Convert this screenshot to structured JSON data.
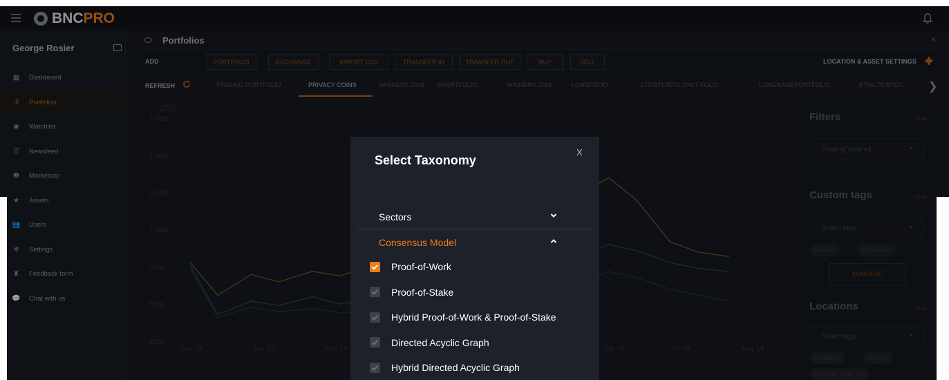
{
  "brand": {
    "name": "BNC",
    "suffix": "PRO"
  },
  "sidebar": {
    "user_name": "George Rosier",
    "items": [
      {
        "label": "Dashboard",
        "icon": "dashboard-icon",
        "active": false
      },
      {
        "label": "Portfolios",
        "icon": "bar-chart-icon",
        "active": true
      },
      {
        "label": "Watchlist",
        "icon": "eye-icon",
        "active": false
      },
      {
        "label": "Newsfeed",
        "icon": "list-icon",
        "active": false
      },
      {
        "label": "Marketcap",
        "icon": "bitcoin-icon",
        "active": false
      },
      {
        "label": "Assets",
        "icon": "star-icon",
        "active": false
      },
      {
        "label": "Users",
        "icon": "users-icon",
        "active": false
      },
      {
        "label": "Settings",
        "icon": "gear-icon",
        "active": false
      },
      {
        "label": "Feedback form",
        "icon": "feedback-icon",
        "active": false
      },
      {
        "label": "Chat with us",
        "icon": "chat-icon",
        "active": false
      }
    ]
  },
  "page": {
    "title": "Portfolios",
    "add_label": "ADD",
    "add_buttons": [
      "PORTFOLIO",
      "EXCHANGE",
      "IMPORT CSV",
      "TRANSFER IN",
      "TRANSFER OUT",
      "BUY",
      "SELL"
    ],
    "location_settings": "LOCATION & ASSET SETTINGS",
    "refresh_label": "REFRESH",
    "tabs": [
      "TRADING PORTFOLIO",
      "PRIVACY COINS",
      "WINNERS 2019",
      "SHORTFOLIO",
      "WINNERS 2018",
      "LONGFOLIO",
      "LTC/BTC/ETC ONLY FOLIO",
      "LONGNAMEPORTFOLIO",
      "ETH/LTC/BTC/..."
    ],
    "active_tab": "PRIVACY COINS"
  },
  "chart_data": {
    "type": "line",
    "ylabel": "USD",
    "y_ticks": [
      "1 750k",
      "1 500k",
      "1 250k",
      "1 000k",
      "750k",
      "500k",
      "250k"
    ],
    "x_ticks": [
      "Dec '18",
      "Jan '19",
      "Feb '19",
      "Jun '19",
      "Jul '19",
      "Aug '19"
    ],
    "ylim": [
      250000,
      1750000
    ],
    "series": [
      {
        "color": "#a5ad2a",
        "x": [
          "2018-12-01",
          "2018-12-15",
          "2019-01-01",
          "2019-01-15",
          "2019-02-01",
          "2019-02-15",
          "2019-06-01",
          "2019-06-15",
          "2019-07-01",
          "2019-07-15",
          "2019-08-01",
          "2019-08-15",
          "2019-08-31"
        ],
        "values": [
          780000,
          560000,
          700000,
          650000,
          720000,
          690000,
          1150000,
          1220000,
          1350000,
          1200000,
          920000,
          850000,
          820000
        ]
      },
      {
        "color": "#2a7d86",
        "x": [
          "2018-12-01",
          "2018-12-15",
          "2019-01-01",
          "2019-01-15",
          "2019-02-01",
          "2019-02-15",
          "2019-06-01",
          "2019-06-15",
          "2019-07-01",
          "2019-07-15",
          "2019-08-01",
          "2019-08-15",
          "2019-08-31"
        ],
        "values": [
          760000,
          430000,
          520000,
          490000,
          550000,
          500000,
          780000,
          820000,
          900000,
          860000,
          780000,
          740000,
          720000
        ]
      },
      {
        "color": "#2f4f5a",
        "x": [
          "2018-12-01",
          "2018-12-15",
          "2019-01-01",
          "2019-01-15",
          "2019-02-01",
          "2019-02-15",
          "2019-06-01",
          "2019-06-15",
          "2019-07-01",
          "2019-07-15",
          "2019-08-01",
          "2019-08-15",
          "2019-08-31"
        ],
        "values": [
          740000,
          410000,
          480000,
          450000,
          470000,
          440000,
          600000,
          640000,
          720000,
          680000,
          600000,
          560000,
          520000
        ]
      }
    ]
  },
  "filters": {
    "title": "Filters",
    "clear": "Clear",
    "select_value": "Trading View #4"
  },
  "custom_tags": {
    "title": "Custom tags",
    "clear": "Clear",
    "placeholder": "Select tags",
    "chips": [
      "Shorts",
      "Big ballers"
    ],
    "manage_label": "MANAGE"
  },
  "locations": {
    "title": "Locations",
    "clear": "Clear",
    "placeholder": "Select tags",
    "chips": [
      "Bitstamp",
      "OKEX",
      "Cold BTC Wallet 2"
    ]
  },
  "modal": {
    "title": "Select Taxonomy",
    "close": "X",
    "sections": [
      {
        "label": "Sectors",
        "open": false
      },
      {
        "label": "Consensus Model",
        "open": true
      }
    ],
    "options": [
      {
        "label": "Proof-of-Work",
        "checked": true
      },
      {
        "label": "Proof-of-Stake",
        "checked": false
      },
      {
        "label": "Hybrid Proof-of-Work & Proof-of-Stake",
        "checked": false
      },
      {
        "label": "Directed Acyclic Graph",
        "checked": false
      },
      {
        "label": "Hybrid Directed Acyclic Graph",
        "checked": false
      }
    ],
    "accent": "#f07d19"
  }
}
